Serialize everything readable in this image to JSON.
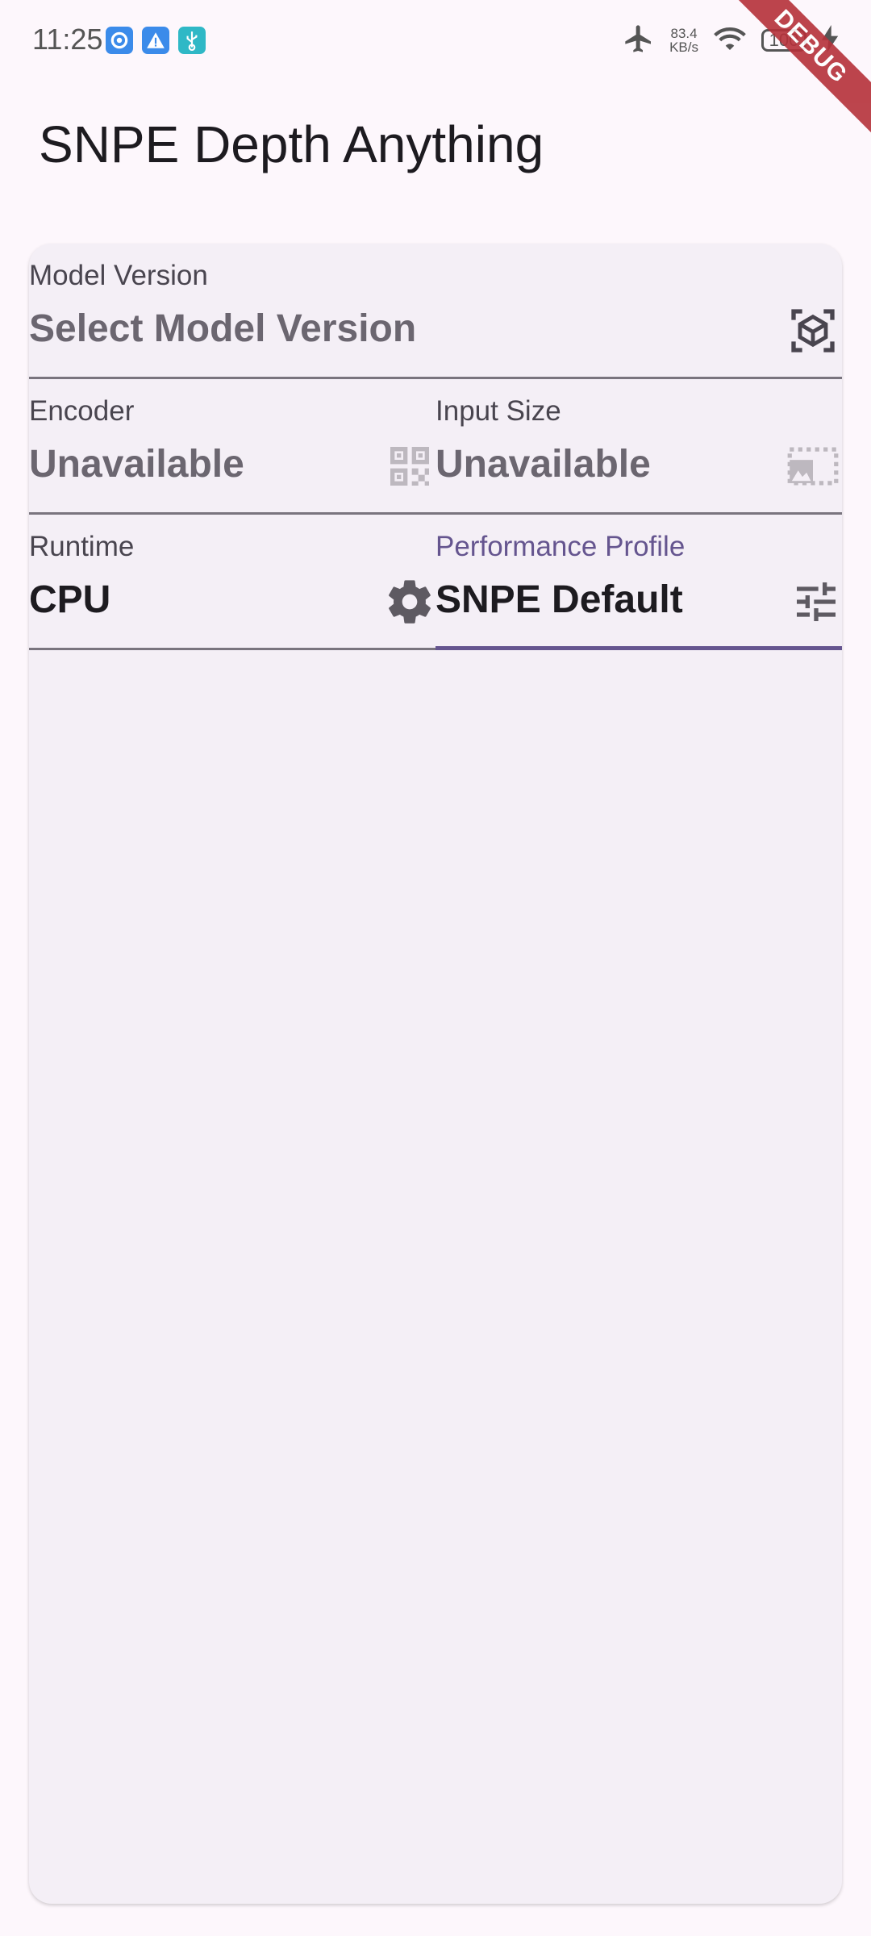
{
  "status_bar": {
    "time": "11:25",
    "speed_value": "83.4",
    "speed_unit": "KB/s",
    "battery": "100"
  },
  "debug_banner": "DEBUG",
  "app_bar": {
    "title": "SNPE Depth Anything"
  },
  "form": {
    "model_version": {
      "label": "Model Version",
      "value": "Select Model Version",
      "icon": "cube-icon"
    },
    "encoder": {
      "label": "Encoder",
      "value": "Unavailable",
      "icon": "qr-code-icon"
    },
    "input_size": {
      "label": "Input Size",
      "value": "Unavailable",
      "icon": "image-size-icon"
    },
    "runtime": {
      "label": "Runtime",
      "value": "CPU",
      "icon": "gear-icon"
    },
    "performance_profile": {
      "label": "Performance Profile",
      "value": "SNPE Default",
      "icon": "sliders-icon"
    }
  },
  "colors": {
    "background": "#FDF7FC",
    "card": "#F4EFF6",
    "accent": "#65558F",
    "debug": "#B5313A"
  }
}
